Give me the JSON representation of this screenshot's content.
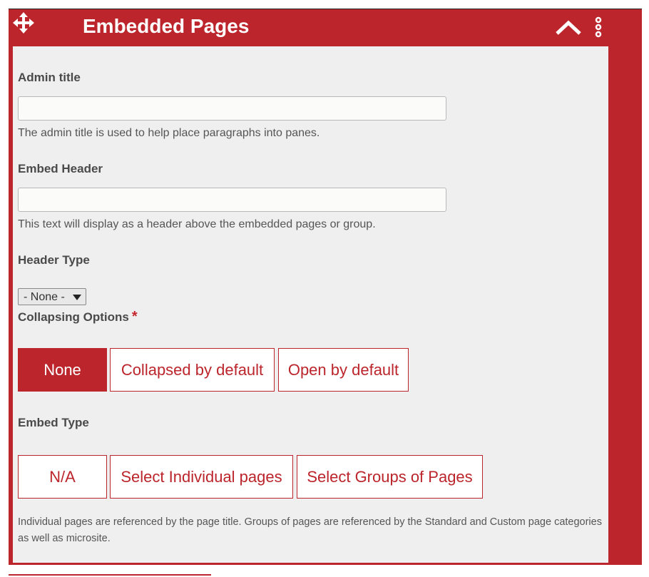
{
  "panel": {
    "title": "Embedded Pages",
    "colors": {
      "accent": "#bb252b",
      "content_bg": "#efefef"
    },
    "icons": {
      "move": "move-arrows-icon",
      "collapse": "chevron-up-icon",
      "menu": "kebab-menu-icon"
    }
  },
  "admin_title": {
    "label": "Admin title",
    "value": "",
    "description": "The admin title is used to help place paragraphs into panes."
  },
  "embed_header": {
    "label": "Embed Header",
    "value": "",
    "description": "This text will display as a header above the embedded pages or group."
  },
  "header_type": {
    "label": "Header Type",
    "selected": "- None -"
  },
  "collapsing": {
    "label": "Collapsing Options",
    "required_mark": "*",
    "options": [
      "None",
      "Collapsed by default",
      "Open by default"
    ],
    "selected": "None"
  },
  "embed_type": {
    "label": "Embed Type",
    "options": [
      "N/A",
      "Select Individual pages",
      "Select Groups of Pages"
    ],
    "help": "Individual pages are referenced by the page title. Groups of pages are referenced by the Standard and Custom page categories as well as microsite."
  }
}
